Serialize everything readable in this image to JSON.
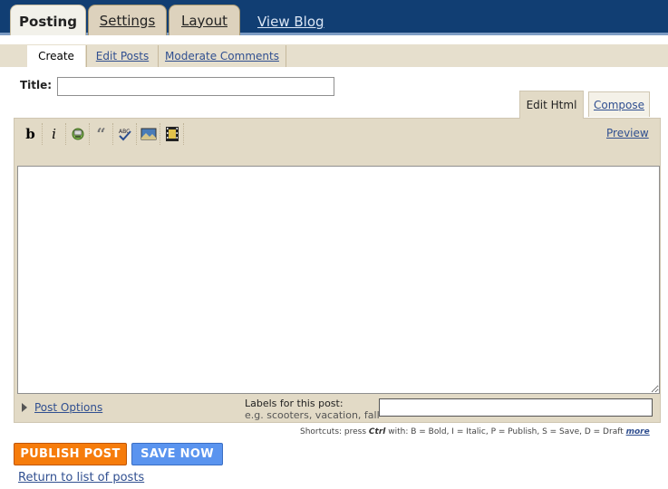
{
  "top_tabs": [
    {
      "label": "Posting",
      "active": true
    },
    {
      "label": "Settings",
      "active": false
    },
    {
      "label": "Layout",
      "active": false
    }
  ],
  "view_blog": "View Blog",
  "sub_tabs": [
    {
      "label": "Create",
      "active": true
    },
    {
      "label": "Edit Posts",
      "active": false
    },
    {
      "label": "Moderate Comments",
      "active": false
    }
  ],
  "title_label": "Title:",
  "title_value": "",
  "editor_tabs": [
    {
      "label": "Edit Html",
      "active": true
    },
    {
      "label": "Compose",
      "active": false
    }
  ],
  "toolbar": {
    "bold": "b",
    "italic": "i",
    "icons": [
      "bold-icon",
      "italic-icon",
      "link-icon",
      "blockquote-icon",
      "spellcheck-icon",
      "image-icon",
      "video-icon"
    ]
  },
  "preview": "Preview",
  "post_body": "",
  "post_options": "Post Options",
  "labels_title": "Labels for this post:",
  "labels_hint": "e.g. scooters, vacation, fall",
  "labels_value": "",
  "shortcuts": {
    "prefix": "Shortcuts: press",
    "ctrl": "Ctrl",
    "with": "with:",
    "items": "B = Bold, I = Italic, P = Publish, S = Save, D = Draft",
    "more": "more"
  },
  "buttons": {
    "publish": "PUBLISH POST",
    "save": "SAVE NOW"
  },
  "return_link": "Return to list of posts",
  "colors": {
    "topbar": "#113e73",
    "tab_beige": "#ddd2bd",
    "panel": "#e2dac6",
    "link": "#304f90",
    "publish": "#f67c0b",
    "save": "#5a94ef"
  }
}
